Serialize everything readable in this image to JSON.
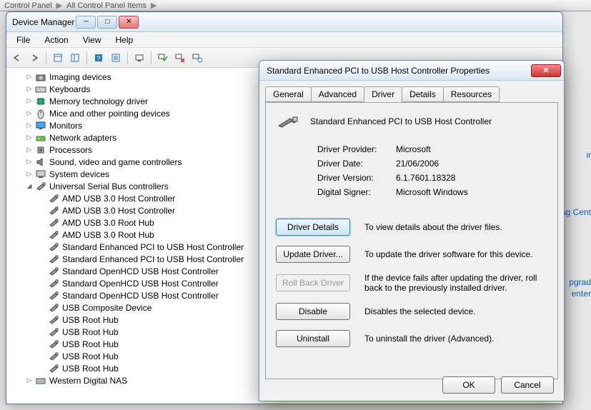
{
  "breadcrumb": {
    "items": [
      "Control Panel",
      "All Control Panel Items"
    ]
  },
  "window": {
    "title": "Device Manager",
    "menus": [
      "File",
      "Action",
      "View",
      "Help"
    ]
  },
  "tree": {
    "categories": [
      {
        "label": "Imaging devices",
        "icon": "camera"
      },
      {
        "label": "Keyboards",
        "icon": "keyboard"
      },
      {
        "label": "Memory technology driver",
        "icon": "chip"
      },
      {
        "label": "Mice and other pointing devices",
        "icon": "mouse"
      },
      {
        "label": "Monitors",
        "icon": "monitor"
      },
      {
        "label": "Network adapters",
        "icon": "network"
      },
      {
        "label": "Processors",
        "icon": "cpu"
      },
      {
        "label": "Sound, video and game controllers",
        "icon": "sound"
      },
      {
        "label": "System devices",
        "icon": "system"
      }
    ],
    "usb_category": {
      "label": "Universal Serial Bus controllers",
      "icon": "usb"
    },
    "usb_items": [
      "AMD USB 3.0 Host Controller",
      "AMD USB 3.0 Host Controller",
      "AMD USB 3.0 Root Hub",
      "AMD USB 3.0 Root Hub",
      "Standard Enhanced PCI to USB Host Controller",
      "Standard Enhanced PCI to USB Host Controller",
      "Standard OpenHCD USB Host Controller",
      "Standard OpenHCD USB Host Controller",
      "Standard OpenHCD USB Host Controller",
      "USB Composite Device",
      "USB Root Hub",
      "USB Root Hub",
      "USB Root Hub",
      "USB Root Hub",
      "USB Root Hub"
    ],
    "last_category": {
      "label": "Western Digital NAS",
      "icon": "drive"
    }
  },
  "dialog": {
    "title": "Standard Enhanced PCI to USB Host Controller Properties",
    "tabs": [
      "General",
      "Advanced",
      "Driver",
      "Details",
      "Resources"
    ],
    "active_tab": 2,
    "device_name": "Standard Enhanced PCI to USB Host Controller",
    "info": {
      "provider_label": "Driver Provider:",
      "provider_value": "Microsoft",
      "date_label": "Driver Date:",
      "date_value": "21/06/2006",
      "version_label": "Driver Version:",
      "version_value": "6.1.7601.18328",
      "signer_label": "Digital Signer:",
      "signer_value": "Microsoft Windows"
    },
    "buttons": {
      "details": {
        "label": "Driver Details",
        "desc": "To view details about the driver files."
      },
      "update": {
        "label": "Update Driver...",
        "desc": "To update the driver software for this device."
      },
      "rollback": {
        "label": "Roll Back Driver",
        "desc": "If the device fails after updating the driver, roll back to the previously installed driver."
      },
      "disable": {
        "label": "Disable",
        "desc": "Disables the selected device."
      },
      "uninstall": {
        "label": "Uninstall",
        "desc": "To uninstall the driver (Advanced)."
      }
    },
    "ok": "OK",
    "cancel": "Cancel"
  },
  "bg_links": [
    "ir",
    "ng Cent",
    "pgrad",
    "enter"
  ]
}
